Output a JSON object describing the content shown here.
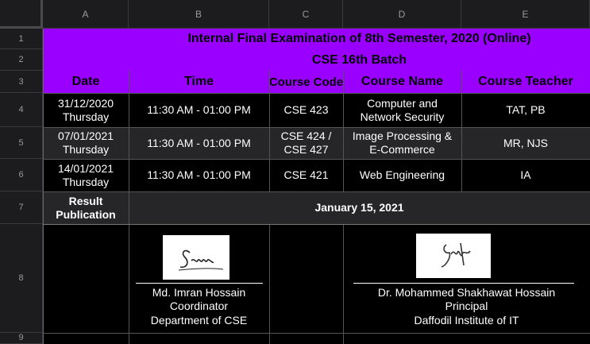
{
  "columns": [
    "A",
    "B",
    "C",
    "D",
    "E"
  ],
  "rows": [
    "1",
    "2",
    "3",
    "4",
    "5",
    "6",
    "7",
    "8",
    "9"
  ],
  "title1": "Internal Final Examination of 8th Semester, 2020 (Online)",
  "title2": "CSE 16th Batch",
  "headers": {
    "date": "Date",
    "time": "Time",
    "course_code": "Course Code",
    "course_name": "Course Name",
    "course_teacher": "Course Teacher"
  },
  "schedule": [
    {
      "date": "31/12/2020",
      "day": "Thursday",
      "time": "11:30 AM - 01:00 PM",
      "code": "CSE 423",
      "name_line1": "Computer and",
      "name_line2": "Network Security",
      "teacher": "TAT, PB"
    },
    {
      "date": "07/01/2021",
      "day": "Thursday",
      "time": "11:30 AM - 01:00 PM",
      "code_line1": "CSE 424 /",
      "code_line2": "CSE 427",
      "name_line1": "Image Processing &",
      "name_line2": "E-Commerce",
      "teacher": "MR, NJS"
    },
    {
      "date": "14/01/2021",
      "day": "Thursday",
      "time": "11:30 AM - 01:00 PM",
      "code": "CSE 421",
      "name": "Web Engineering",
      "teacher": "IA"
    }
  ],
  "result": {
    "label_line1": "Result",
    "label_line2": "Publication",
    "date": "January 15, 2021"
  },
  "signatures": [
    {
      "name": "Md. Imran Hossain",
      "role": "Coordinator",
      "org": "Department of CSE"
    },
    {
      "name": "Dr. Mohammed Shakhawat Hossain",
      "role": "Principal",
      "org": "Daffodil Institute of IT"
    }
  ],
  "colors": {
    "header_purple": "#9a00ff",
    "cell_bg": "#000000",
    "alt_bg": "#262628",
    "grid": "#555555"
  }
}
